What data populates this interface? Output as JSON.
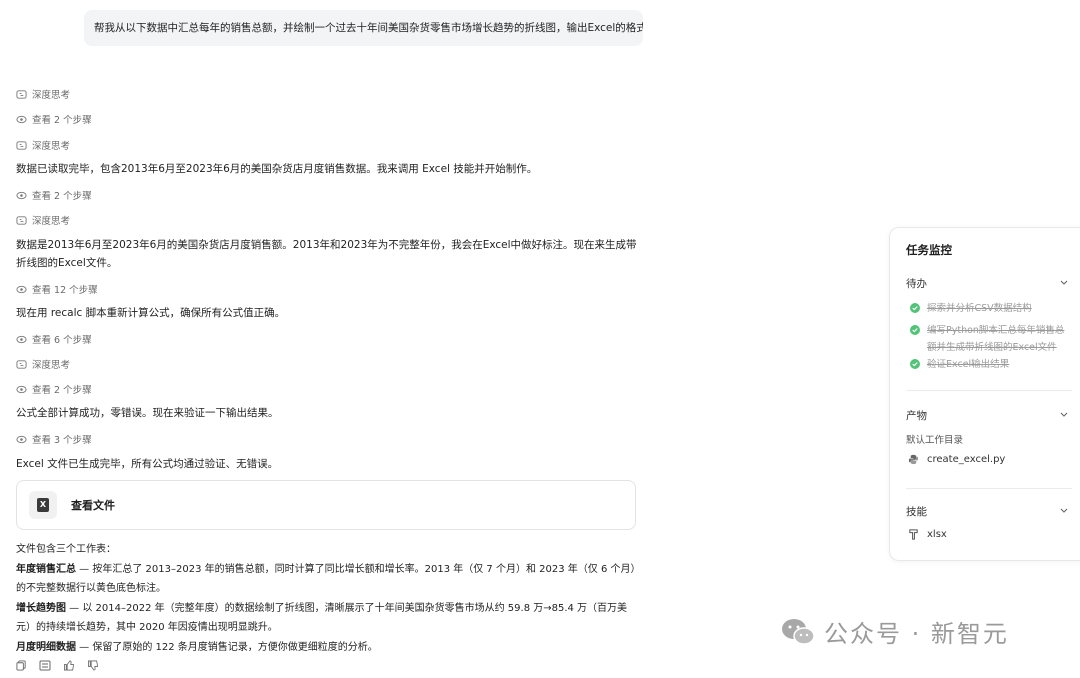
{
  "user_message": "帮我从以下数据中汇总每年的销售总额，并绘制一个过去十年间美国杂货零售市场增长趋势的折线图，输出Excel的格式",
  "chat": {
    "think1": "深度思考",
    "steps1": "查看 2 个步骤",
    "think2": "深度思考",
    "msg1": "数据已读取完毕，包含2013年6月至2023年6月的美国杂货店月度销售数据。我来调用 Excel 技能并开始制作。",
    "steps2": "查看 2 个步骤",
    "think3": "深度思考",
    "msg2": "数据是2013年6月至2023年6月的美国杂货店月度销售额。2013年和2023年为不完整年份，我会在Excel中做好标注。现在来生成带折线图的Excel文件。",
    "steps3": "查看 12 个步骤",
    "msg3": "现在用 recalc 脚本重新计算公式，确保所有公式值正确。",
    "steps4": "查看 6 个步骤",
    "think4": "深度思考",
    "steps5": "查看 2 个步骤",
    "msg4": "公式全部计算成功，零错误。现在来验证一下输出结果。",
    "steps6": "查看 3 个步骤",
    "msg5": "Excel 文件已生成完毕，所有公式均通过验证、无错误。",
    "file_card": {
      "icon_letter": "X",
      "label": "查看文件"
    },
    "summary": {
      "intro": "文件包含三个工作表：",
      "s1_title": "年度销售汇总",
      "s1_text": " — 按年汇总了 2013–2023 年的销售总额，同时计算了同比增长额和增长率。2013 年（仅 7 个月）和 2023 年（仅 6 个月）的不完整数据行以黄色底色标注。",
      "s2_title": "增长趋势图",
      "s2_text": " — 以 2014–2022 年（完整年度）的数据绘制了折线图，清晰展示了十年间美国杂货零售市场从约 59.8 万→85.4 万（百万美元）的持续增长趋势，其中 2020 年因疫情出现明显跳升。",
      "s3_title": "月度明细数据",
      "s3_text": " — 保留了原始的 122 条月度销售记录，方便你做更细粒度的分析。"
    }
  },
  "monitor": {
    "title": "任务监控",
    "todo": {
      "label": "待办",
      "items": [
        "探索并分析CSV数据结构",
        "编写Python脚本汇总每年销售总额并生成带折线图的Excel文件",
        "验证Excel输出结果"
      ]
    },
    "artifacts": {
      "label": "产物",
      "dir": "默认工作目录",
      "file": "create_excel.py"
    },
    "skills": {
      "label": "技能",
      "item": "xlsx"
    }
  },
  "watermark": "公众号 · 新智元",
  "colors": {
    "check_green": "#52c477",
    "bubble_bg": "#f3f4f5"
  }
}
